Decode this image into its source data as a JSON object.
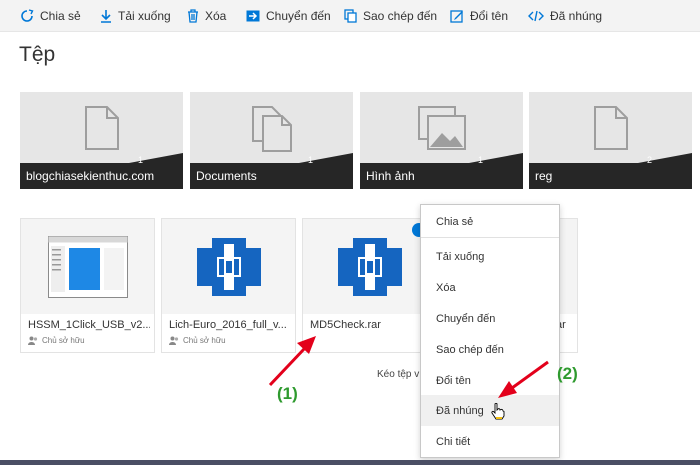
{
  "toolbar": {
    "share_label": "Chia sẻ",
    "download_label": "Tải xuống",
    "delete_label": "Xóa",
    "move_label": "Chuyển đến",
    "copy_label": "Sao chép đến",
    "rename_label": "Đổi tên",
    "embed_label": "Đã nhúng"
  },
  "page": {
    "title": "Tệp"
  },
  "folders": [
    {
      "name": "blogchiasekienthuc.com",
      "count": "1",
      "icon": "document-icon"
    },
    {
      "name": "Documents",
      "count": "1",
      "icon": "documents-icon"
    },
    {
      "name": "Hình ảnh",
      "count": "1",
      "icon": "image-icon"
    },
    {
      "name": "reg",
      "count": "2",
      "icon": "document-icon"
    }
  ],
  "files": [
    {
      "name": "HSSM_1Click_USB_v2...",
      "owner": "Chủ sở hữu",
      "thumb": "screenshot-thumbnail"
    },
    {
      "name": "Lich-Euro_2016_full_v...",
      "owner": "Chủ sở hữu",
      "thumb": "archive-icon"
    },
    {
      "name": "MD5Check.rar",
      "owner": "",
      "thumb": "archive-icon"
    },
    {
      "name": "ar",
      "owner": "",
      "thumb": ""
    }
  ],
  "drag_hint": "Kéo tệp v",
  "context_menu": {
    "items": [
      {
        "label": "Chia sẻ"
      },
      {
        "label": "Tải xuống"
      },
      {
        "label": "Xóa"
      },
      {
        "label": "Chuyển đến"
      },
      {
        "label": "Sao chép đến"
      },
      {
        "label": "Đổi tên"
      },
      {
        "label": "Đã nhúng"
      },
      {
        "label": "Chi tiết"
      }
    ],
    "hovered_index": 6
  },
  "annotations": {
    "label_1": "(1)",
    "label_2": "(2)"
  },
  "colors": {
    "accent": "#0078d7",
    "folder_bar": "#262626",
    "arrow": "#e3001b",
    "annotation": "#2e9a2e"
  }
}
